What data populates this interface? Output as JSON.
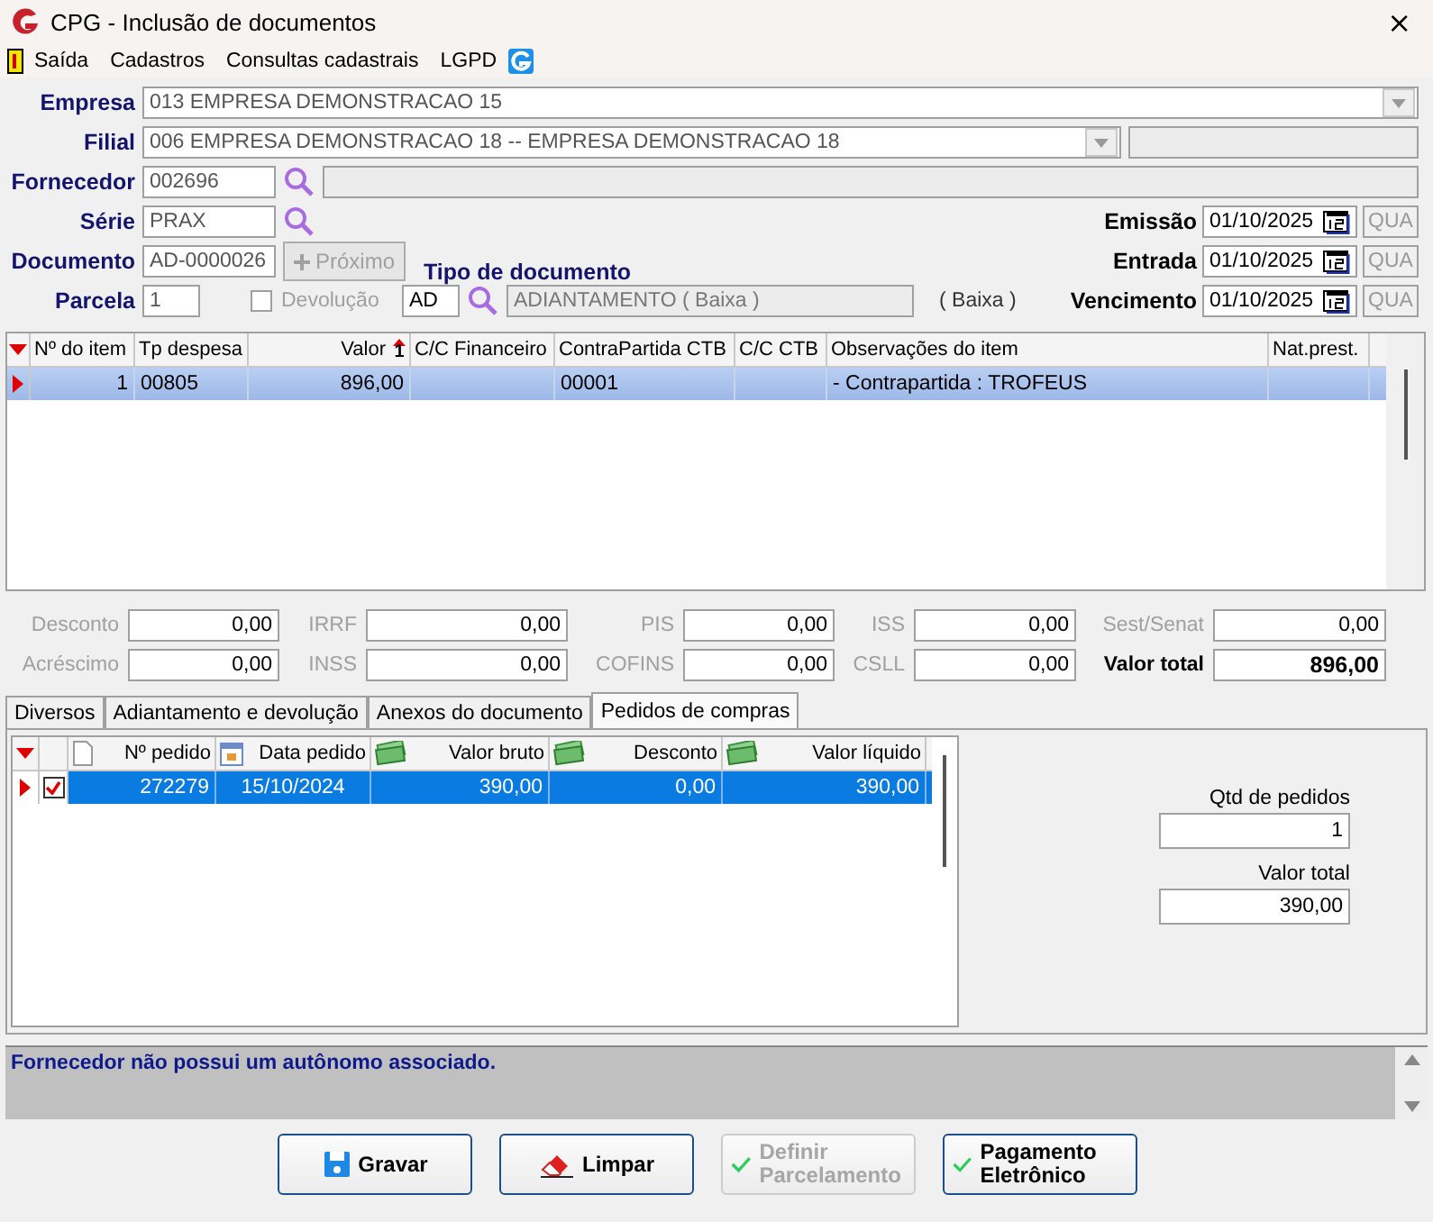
{
  "window": {
    "title": "CPG - Inclusão de documentos",
    "close": "×"
  },
  "menu": [
    "Saída",
    "Cadastros",
    "Consultas cadastrais",
    "LGPD"
  ],
  "header": {
    "empresa": {
      "label": "Empresa",
      "value": "013 EMPRESA DEMONSTRACAO 15"
    },
    "filial": {
      "label": "Filial",
      "value": "006 EMPRESA DEMONSTRACAO 18 -- EMPRESA DEMONSTRACAO 18"
    },
    "fornecedor": {
      "label": "Fornecedor",
      "value": "002696"
    },
    "serie": {
      "label": "Série",
      "value": "PRAX"
    },
    "documento": {
      "label": "Documento",
      "value": "AD-0000026"
    },
    "proximo": {
      "label": "Próximo",
      "disabled": true
    },
    "parcela": {
      "label": "Parcela",
      "value": "1"
    },
    "devolucao": {
      "label": "Devolução",
      "checked": false,
      "disabled": true
    },
    "tipo_documento": {
      "label": "Tipo de documento",
      "code": "AD",
      "description": "ADIANTAMENTO ( Baixa )",
      "note": "( Baixa )"
    },
    "dates": [
      {
        "label": "Emissão",
        "value": "01/10/2025",
        "weekday": "QUA"
      },
      {
        "label": "Entrada",
        "value": "01/10/2025",
        "weekday": "QUA"
      },
      {
        "label": "Vencimento",
        "value": "01/10/2025",
        "weekday": "QUA"
      }
    ]
  },
  "items": {
    "columns": [
      {
        "label": "Nº do item"
      },
      {
        "label": "Tp despesa"
      },
      {
        "label": "Valor",
        "sort_mark": "1"
      },
      {
        "label": "C/C Financeiro"
      },
      {
        "label": "ContraPartida CTB"
      },
      {
        "label": "C/C CTB"
      },
      {
        "label": "Observações do item"
      },
      {
        "label": "Nat.prest."
      }
    ],
    "rows": [
      {
        "selected": true,
        "cells": [
          "1",
          "00805",
          "896,00",
          "",
          "00001",
          "",
          "- Contrapartida : TROFEUS",
          ""
        ]
      }
    ]
  },
  "totals": [
    {
      "label": "Desconto",
      "value": "0,00",
      "kind": "field"
    },
    {
      "label": "IRRF",
      "value": "0,00",
      "kind": "field"
    },
    {
      "label": "PIS",
      "value": "0,00",
      "kind": "field"
    },
    {
      "label": "ISS",
      "value": "0,00",
      "kind": "field"
    },
    {
      "label": "Sest/Senat",
      "value": "0,00",
      "kind": "field"
    },
    {
      "label": "Acréscimo",
      "value": "0,00",
      "kind": "field"
    },
    {
      "label": "INSS",
      "value": "0,00",
      "kind": "field"
    },
    {
      "label": "COFINS",
      "value": "0,00",
      "kind": "field"
    },
    {
      "label": "CSLL",
      "value": "0,00",
      "kind": "field"
    },
    {
      "label": "Valor total",
      "value": "896,00",
      "kind": "total"
    }
  ],
  "tabs": [
    {
      "label": "Diversos",
      "selected": false
    },
    {
      "label": "Adiantamento e devolução",
      "selected": false
    },
    {
      "label": "Anexos do documento",
      "selected": false
    },
    {
      "label": "Pedidos de compras",
      "selected": true
    }
  ],
  "orders": {
    "columns": [
      {
        "label": "Nº pedido",
        "kind": "document"
      },
      {
        "label": "Data pedido",
        "kind": "calendar"
      },
      {
        "label": "Valor bruto",
        "kind": "money"
      },
      {
        "label": "Desconto",
        "kind": "money"
      },
      {
        "label": "Valor líquido",
        "kind": "money"
      }
    ],
    "rows": [
      {
        "selected": true,
        "checked": true,
        "cells": [
          "272279",
          "15/10/2024",
          "390,00",
          "0,00",
          "390,00"
        ]
      }
    ],
    "summary": [
      {
        "label": "Qtd de pedidos",
        "value": "1"
      },
      {
        "label": "Valor total",
        "value": "390,00"
      }
    ]
  },
  "message": "Fornecedor não possui um autônomo associado.",
  "buttons": [
    {
      "label": "Gravar",
      "kind": "save",
      "disabled": false
    },
    {
      "label": "Limpar",
      "kind": "clear",
      "disabled": false
    },
    {
      "label": "Definir Parcelamento",
      "kind": "confirm",
      "disabled": true
    },
    {
      "label": "Pagamento Eletrônico",
      "kind": "confirm",
      "disabled": false
    }
  ]
}
